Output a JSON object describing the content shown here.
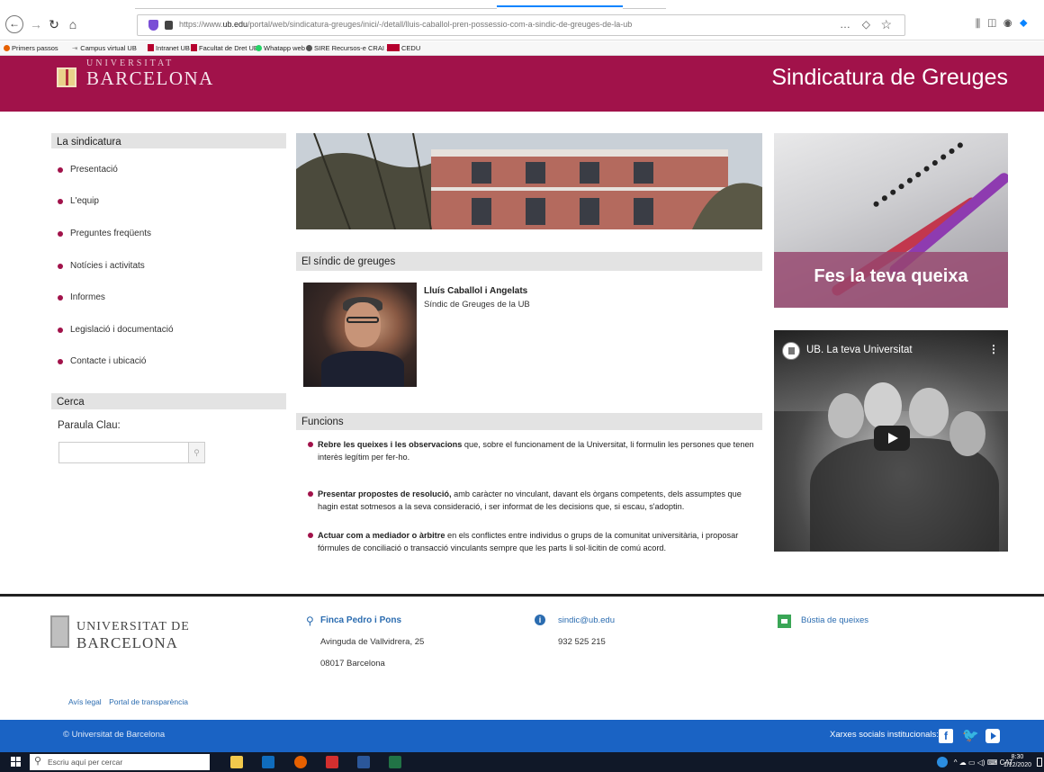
{
  "browser": {
    "url_prefix": "https://www.",
    "url_domain": "ub.edu",
    "url_path": "/portal/web/sindicatura-greuges/inici/-/detall/lluis-caballol-pren-possessio-com-a-sindic-de-greuges-de-la-ub",
    "more_icon": "…",
    "star_icon": "☆"
  },
  "bookmarks": [
    {
      "label": "Primers passos",
      "icon": "firefox-icon",
      "color": "#e66000"
    },
    {
      "label": "Campus virtual UB",
      "icon": "arrow-icon",
      "color": "#888888"
    },
    {
      "label": "Intranet UB",
      "icon": "ub-icon",
      "color": "#b5002e"
    },
    {
      "label": "Facultat de Dret UB",
      "icon": "ub-icon",
      "color": "#b5002e"
    },
    {
      "label": "Whatapp web",
      "icon": "whatsapp-icon",
      "color": "#25d366"
    },
    {
      "label": "SIRE Recursos-e CRAI ...",
      "icon": "globe-icon",
      "color": "#555555"
    },
    {
      "label": "CEDU",
      "icon": "cedu-icon",
      "color": "#b5002e"
    }
  ],
  "header": {
    "logo_top": "UNIVERSITAT",
    "logo_text": "BARCELONA",
    "title": "Sindicatura de Greuges",
    "bg_color": "#a1124a"
  },
  "sidebar": {
    "heading": "La sindicatura",
    "items": [
      {
        "label": "Presentació"
      },
      {
        "label": "L'equip"
      },
      {
        "label": "Preguntes freqüents"
      },
      {
        "label": "Notícies i activitats"
      },
      {
        "label": "Informes"
      },
      {
        "label": "Legislació i documentació"
      },
      {
        "label": "Contacte i ubicació"
      }
    ]
  },
  "search": {
    "heading": "Cerca",
    "label": "Paraula Clau:",
    "placeholder": "",
    "button_icon": "search-icon"
  },
  "sindic": {
    "heading": "El síndic de greuges",
    "name": "Lluís Caballol i Angelats",
    "role": "Síndic de Greuges de la UB"
  },
  "funcions": {
    "heading": "Funcions",
    "items": [
      {
        "bold": "Rebre les queixes i les observacions",
        "text": " que, sobre el funcionament de la Universitat, li formulin les persones que tenen interès legítim per fer-ho."
      },
      {
        "bold": "Presentar propostes de resolució,",
        "text": " amb caràcter no vinculant, davant els òrgans competents, dels assumptes que hagin estat sotmesos a la seva consideració, i ser informat de les decisions que, si escau, s'adoptin."
      },
      {
        "bold": "Actuar com a mediador o àrbitre",
        "text": " en els conflictes entre individus o grups de la comunitat universitària, i proposar fórmules de conciliació o transacció vinculants sempre que les parts li sol·licitin de comú acord."
      }
    ]
  },
  "promo": {
    "label": "Fes la teva queixa"
  },
  "video": {
    "title": "UB. La teva Universitat",
    "menu_icon": "⋮"
  },
  "footer": {
    "logo_t1": "UNIVERSITAT DE",
    "logo_t2": "BARCELONA",
    "address_title": "Finca Pedro i Pons",
    "address_line1": "Avinguda de Vallvidrera, 25",
    "address_line2": "08017 Barcelona",
    "email": "sindic@ub.edu",
    "phone": "932 525 215",
    "bustia": "Bústia de queixes",
    "links": [
      "Avís legal",
      "Portal de transparència"
    ],
    "copyright": "© Universitat de Barcelona",
    "social_label": "Xarxes socials institucionals:"
  },
  "taskbar": {
    "search_placeholder": "Escriu aquí per cercar",
    "lang": "CAT",
    "time": "8:30",
    "date": "1/12/2020",
    "apps": [
      {
        "icon": "file-explorer-icon",
        "color": "#f2c94c"
      },
      {
        "icon": "outlook-icon",
        "color": "#0f6cbd"
      },
      {
        "icon": "firefox-icon",
        "color": "#e66000"
      },
      {
        "icon": "acrobat-icon",
        "color": "#d32f2f"
      },
      {
        "icon": "word-icon",
        "color": "#2b579a"
      },
      {
        "icon": "excel-icon",
        "color": "#217346"
      }
    ]
  }
}
